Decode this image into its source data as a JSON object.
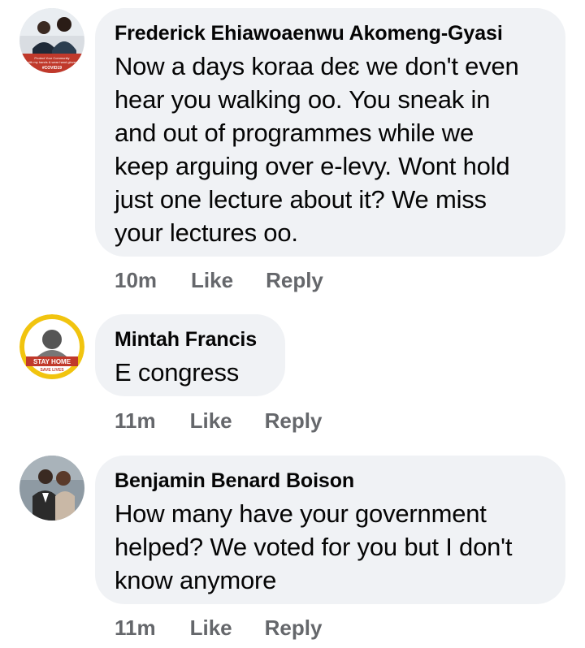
{
  "comments": [
    {
      "author": "Frederick Ehiawoaenwu Akomeng-Gyasi",
      "text": "Now a days koraa deɛ we don't even\nhear you walking oo. You sneak in\nand out of programmes while we\nkeep arguing over e-levy. Wont hold\njust one lecture about it? We miss\nyour lectures oo.",
      "time": "10m",
      "like_label": "Like",
      "reply_label": "Reply",
      "avatar": {
        "caption": "Protect Your Community with my hands & wear hand gloves",
        "badge": "#COVID19",
        "accent": "#c0392b"
      }
    },
    {
      "author": "Mintah Francis",
      "text": "E congress",
      "time": "11m",
      "like_label": "Like",
      "reply_label": "Reply",
      "avatar": {
        "banner": "STAY HOME",
        "sub": "SAVE LIVES",
        "accent": "#f1c40f"
      }
    },
    {
      "author": "Benjamin Benard Boison",
      "text": "How many have your government\nhelped? We voted for you but I don't\nknow anymore",
      "time": "11m",
      "like_label": "Like",
      "reply_label": "Reply",
      "avatar": {
        "accent": "#8e9aa3"
      }
    }
  ],
  "colors": {
    "bubble": "#f0f2f5",
    "meta": "#65676b",
    "text": "#050505"
  }
}
